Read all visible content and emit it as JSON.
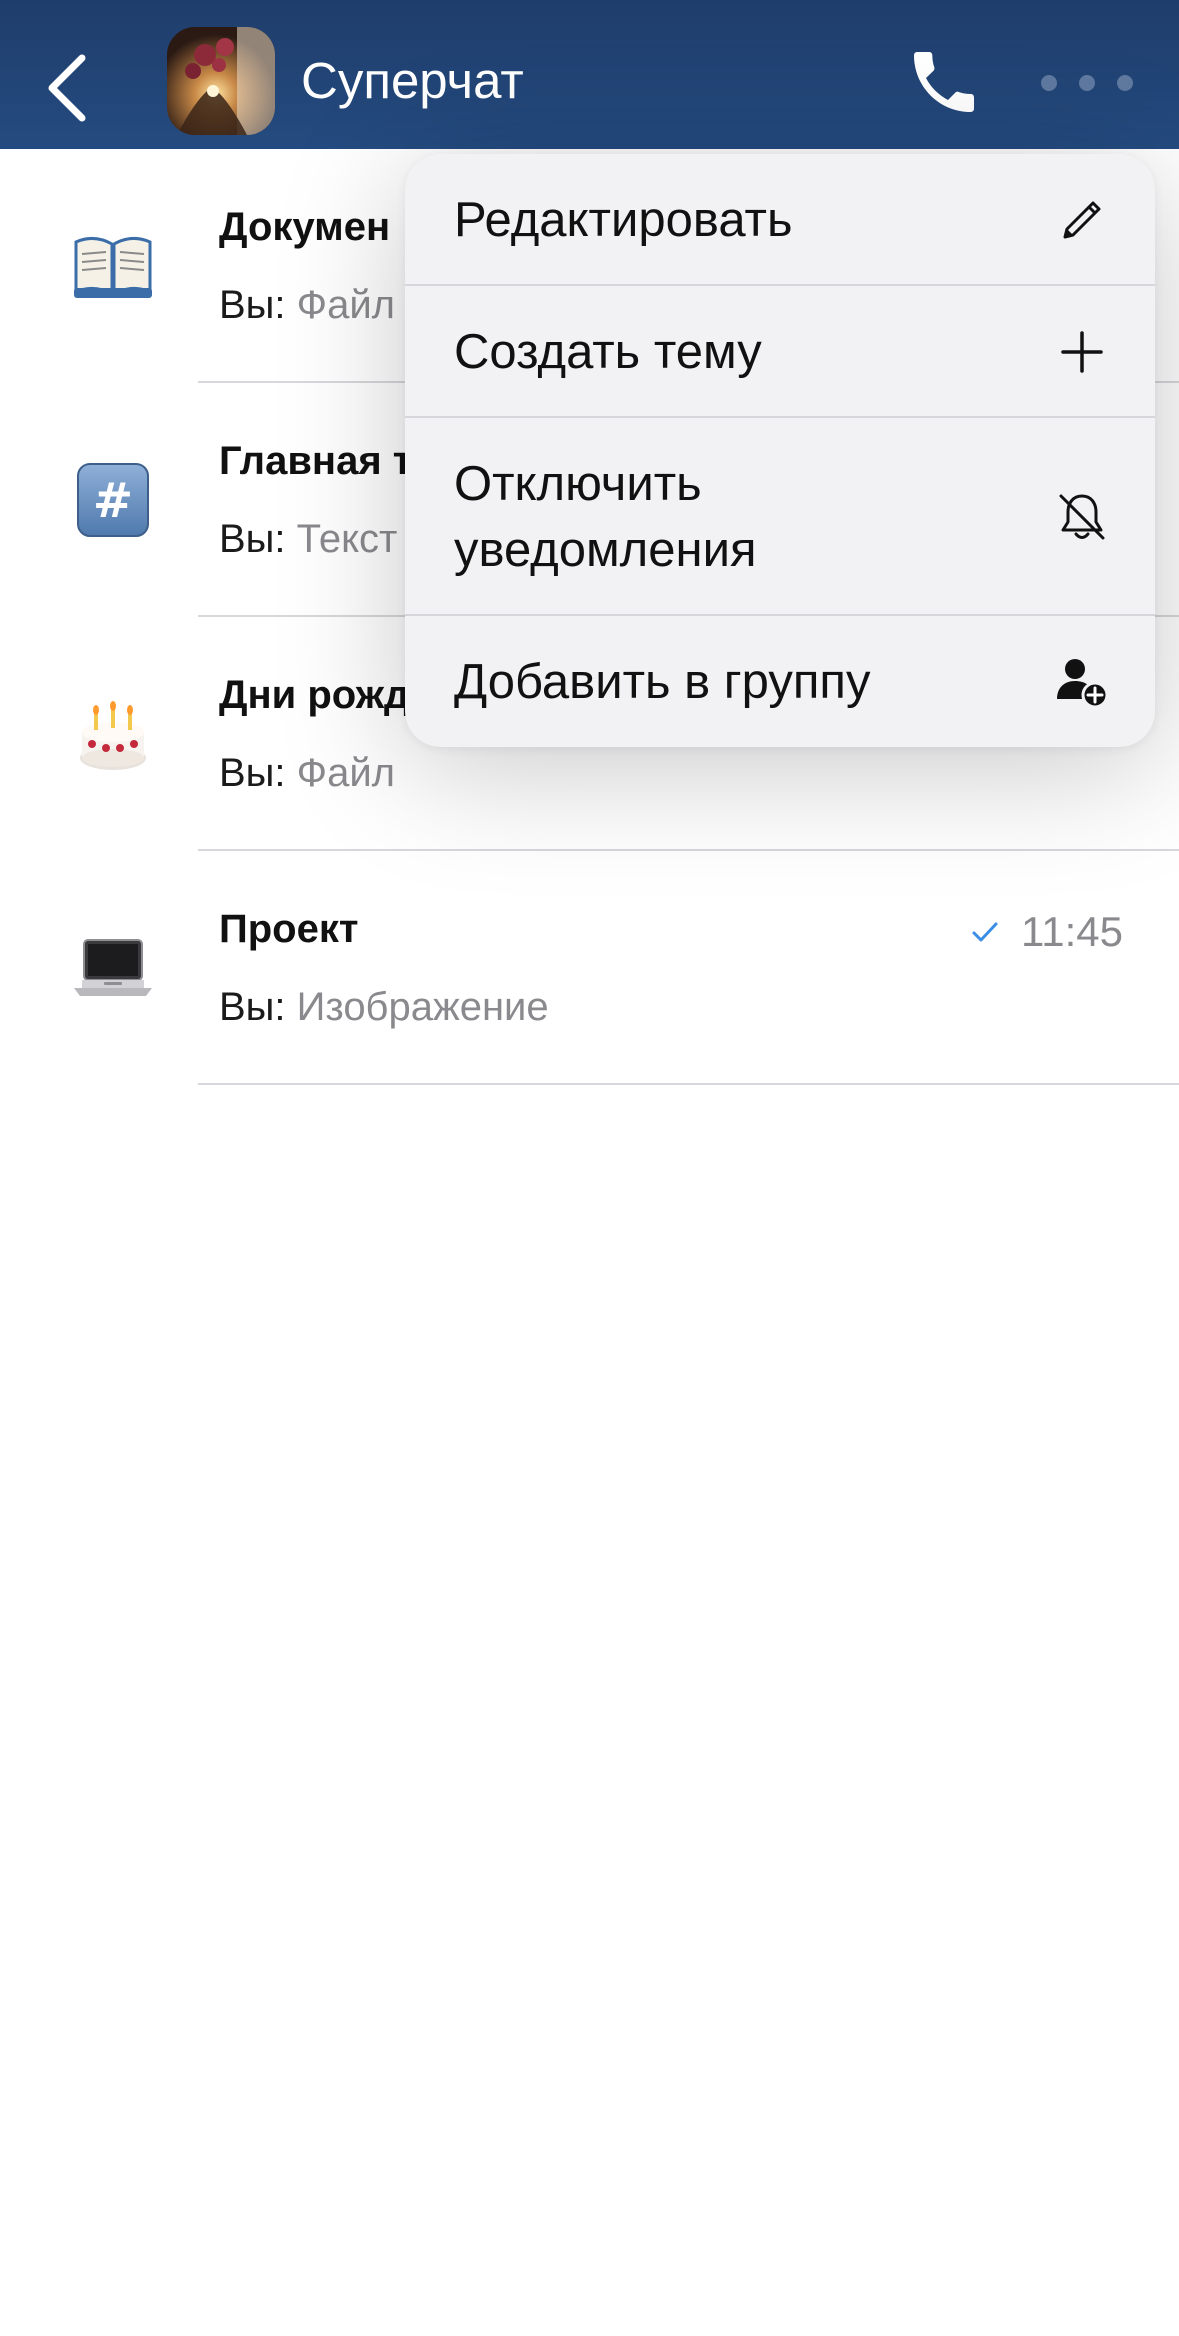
{
  "header": {
    "title": "Суперчат",
    "back_icon": "chevron-left-icon",
    "call_icon": "phone-icon",
    "more_icon": "ellipsis-icon",
    "background": "#1f3d6b"
  },
  "topics": [
    {
      "icon": "open-book-icon",
      "title": "Докумен",
      "sender": "Вы:",
      "preview": "Файл",
      "time": "",
      "read_check": false
    },
    {
      "icon": "hash-icon",
      "title": "Главная т",
      "sender": "Вы:",
      "preview": "Текст",
      "time": "",
      "read_check": false
    },
    {
      "icon": "cake-icon",
      "title": "Дни рожд",
      "sender": "Вы:",
      "preview": "Файл",
      "time": "",
      "read_check": false
    },
    {
      "icon": "laptop-icon",
      "title": "Проект",
      "sender": "Вы:",
      "preview": "Изображение",
      "time": "11:45",
      "read_check": true
    }
  ],
  "menu": {
    "items": [
      {
        "label": "Редактировать",
        "icon": "pencil-icon"
      },
      {
        "label": "Создать тему",
        "icon": "plus-icon"
      },
      {
        "label": "Отключить\nуведомления",
        "icon": "bell-off-icon"
      },
      {
        "label": "Добавить в группу",
        "icon": "add-user-icon"
      }
    ]
  },
  "colors": {
    "accent_check": "#3a8ee6",
    "secondary_text": "#8a8a8e"
  }
}
